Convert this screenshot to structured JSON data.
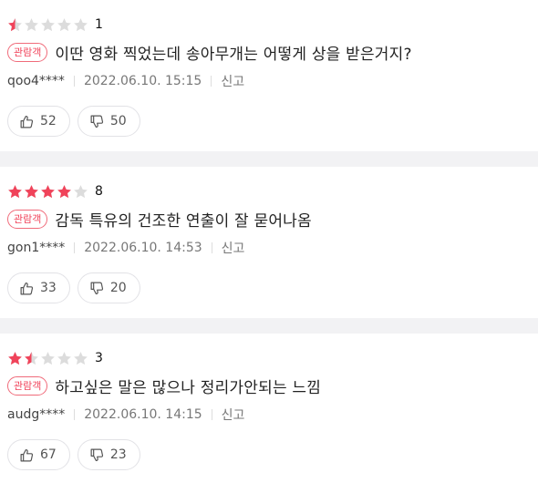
{
  "colors": {
    "star_filled": "#f0435a",
    "star_empty": "#dcdcdc",
    "badge": "#f0435a"
  },
  "reviews": [
    {
      "stars": 0.5,
      "score": "1",
      "badge": "관람객",
      "comment": "이딴 영화 찍었는데 송아무개는 어떻게 상을 받은거지?",
      "author": "qoo4****",
      "date": "2022.06.10. 15:15",
      "report": "신고",
      "likes": "52",
      "dislikes": "50"
    },
    {
      "stars": 4,
      "score": "8",
      "badge": "관람객",
      "comment": "감독 특유의 건조한 연출이 잘 묻어나옴",
      "author": "gon1****",
      "date": "2022.06.10. 14:53",
      "report": "신고",
      "likes": "33",
      "dislikes": "20"
    },
    {
      "stars": 1.5,
      "score": "3",
      "badge": "관람객",
      "comment": "하고싶은 말은 많으나 정리가안되는 느낌",
      "author": "audg****",
      "date": "2022.06.10. 14:15",
      "report": "신고",
      "likes": "67",
      "dislikes": "23"
    }
  ]
}
